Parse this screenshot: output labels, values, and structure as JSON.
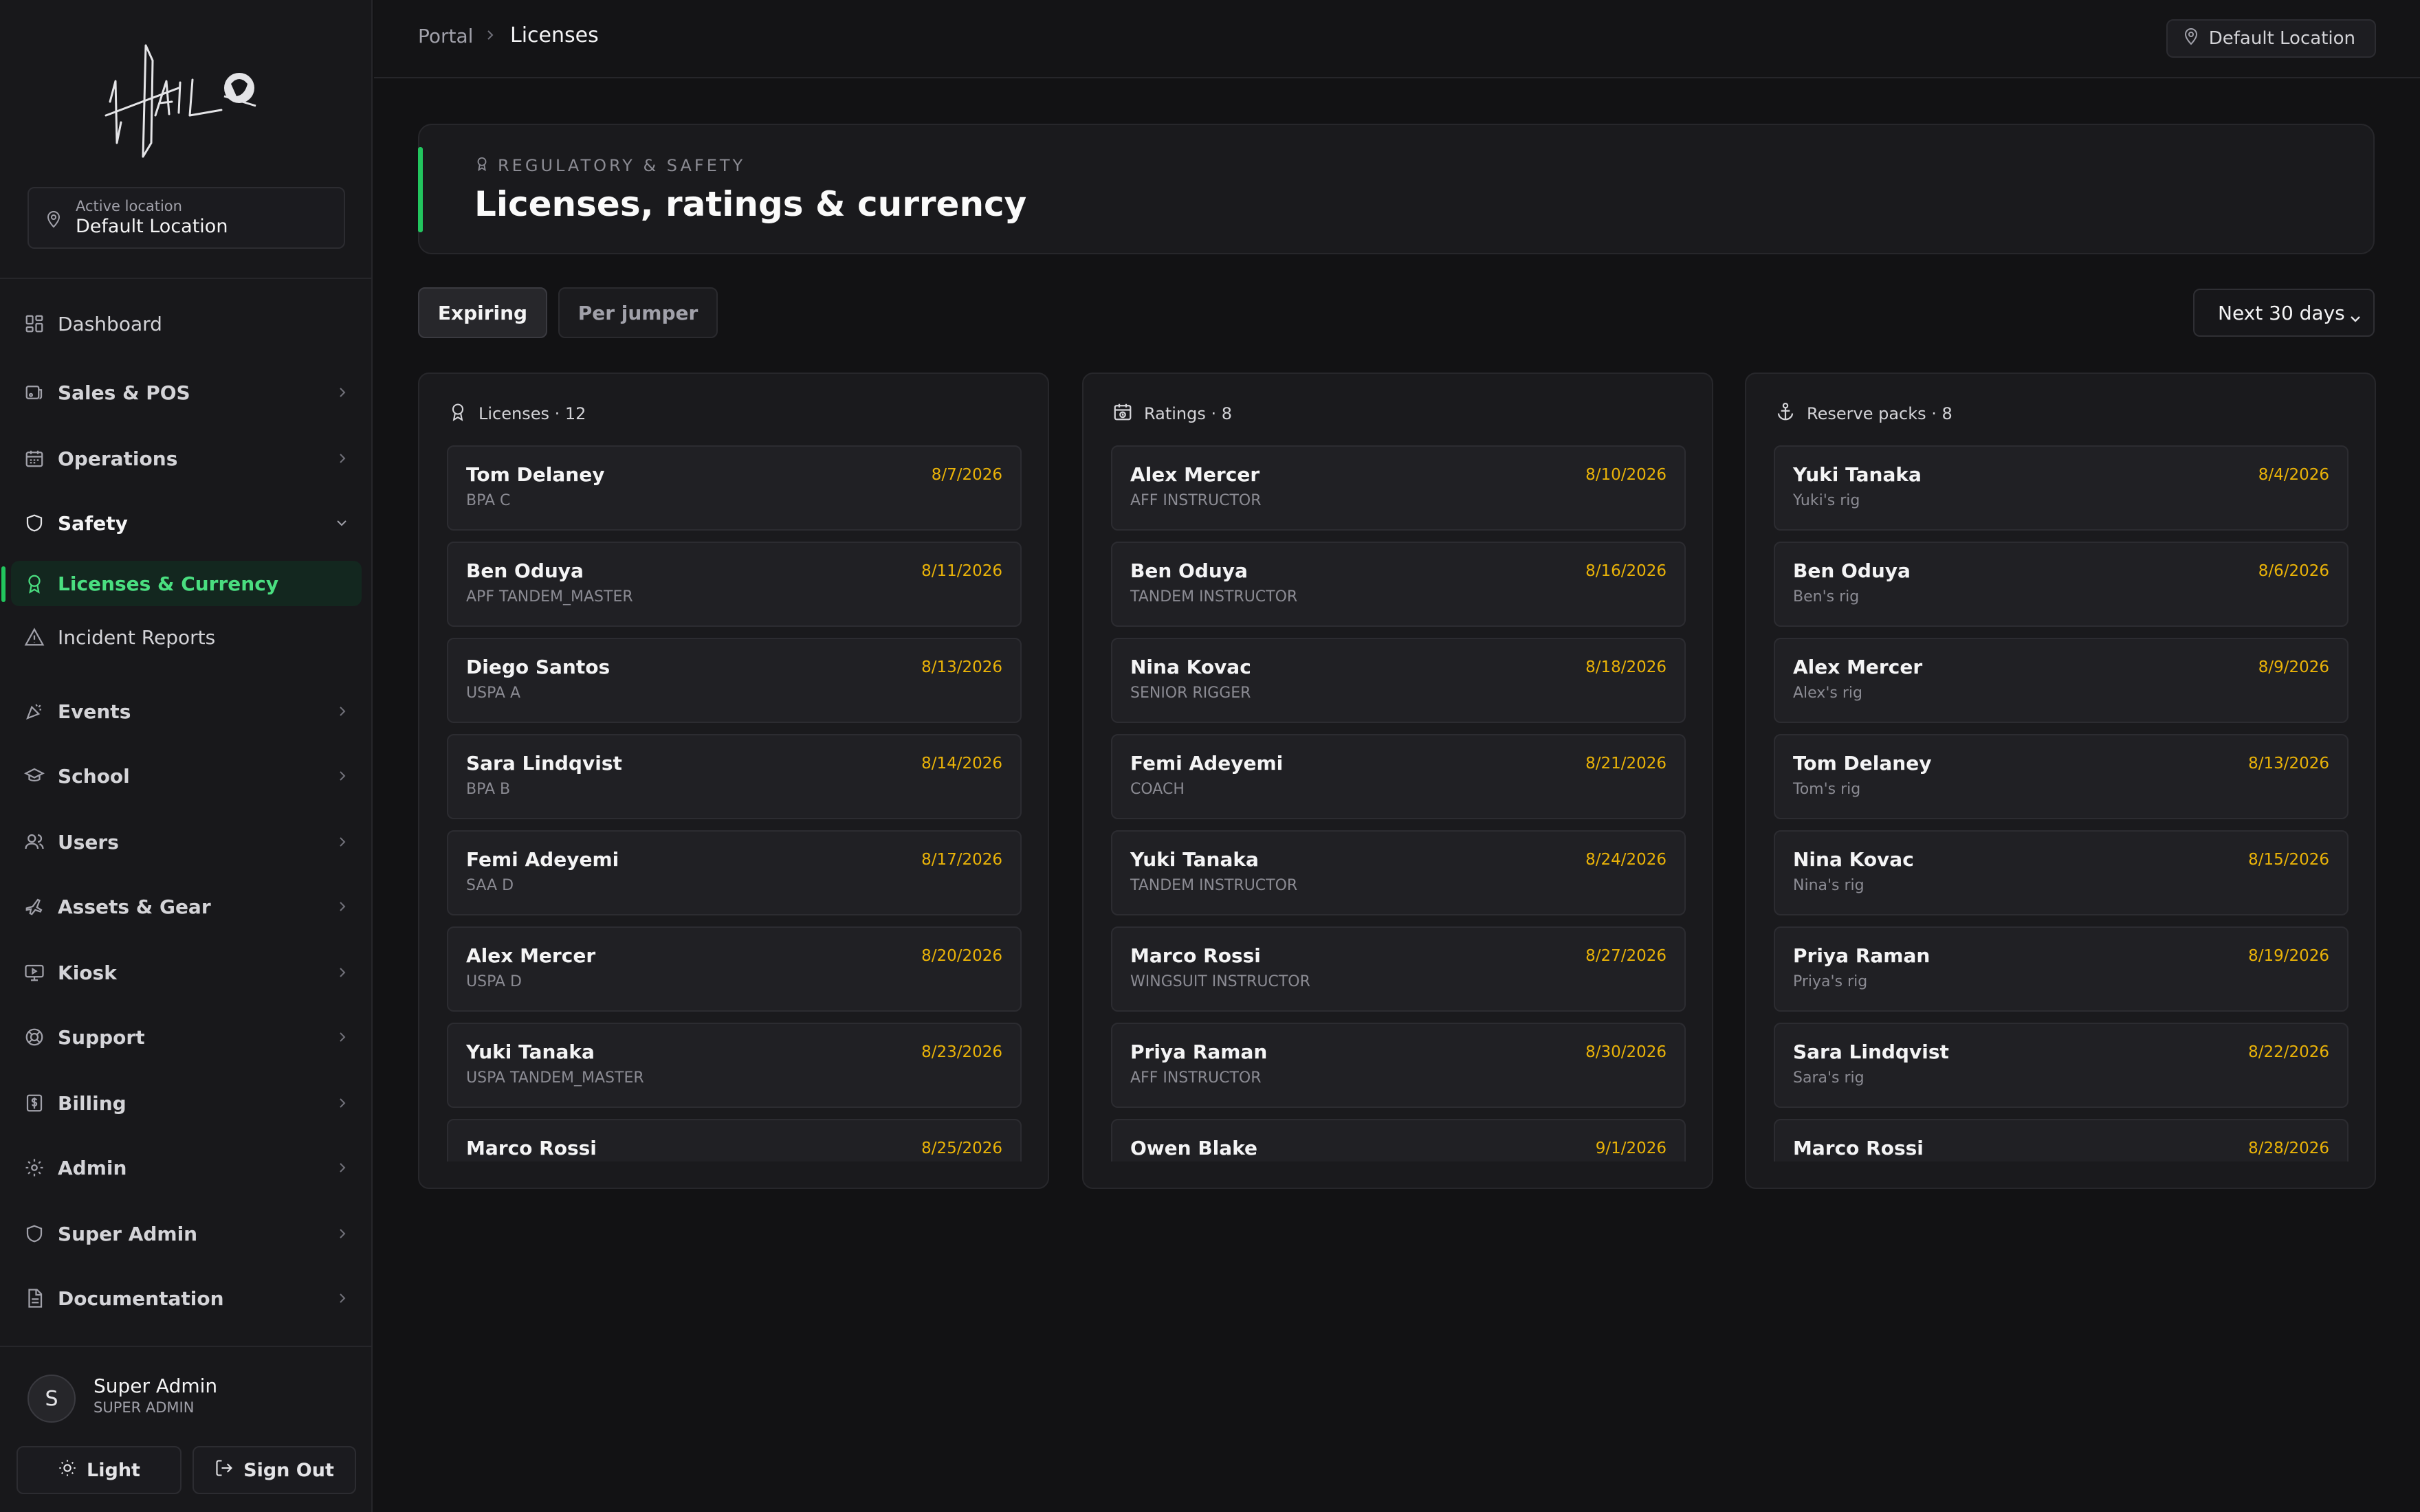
{
  "sidebar": {
    "active_location_label": "Active location",
    "active_location_value": "Default Location",
    "nav": [
      {
        "label": "Dashboard",
        "icon": "grid-icon"
      },
      {
        "label": "Sales & POS",
        "icon": "receipt-icon"
      },
      {
        "label": "Operations",
        "icon": "calendar-icon"
      },
      {
        "label": "Safety",
        "icon": "shield-icon"
      },
      {
        "label": "Licenses & Currency",
        "icon": "award-icon"
      },
      {
        "label": "Incident Reports",
        "icon": "warning-icon"
      },
      {
        "label": "Events",
        "icon": "party-icon"
      },
      {
        "label": "School",
        "icon": "graduation-cap-icon"
      },
      {
        "label": "Users",
        "icon": "users-icon"
      },
      {
        "label": "Assets & Gear",
        "icon": "plane-icon"
      },
      {
        "label": "Kiosk",
        "icon": "monitor-play-icon"
      },
      {
        "label": "Support",
        "icon": "lifebuoy-icon"
      },
      {
        "label": "Billing",
        "icon": "dollar-icon"
      },
      {
        "label": "Admin",
        "icon": "gear-icon"
      },
      {
        "label": "Super Admin",
        "icon": "shield-icon"
      },
      {
        "label": "Documentation",
        "icon": "document-icon"
      }
    ],
    "user": {
      "initial": "S",
      "name": "Super Admin",
      "role": "SUPER ADMIN"
    },
    "theme_button": "Light",
    "signout_button": "Sign Out"
  },
  "topbar": {
    "crumb_root": "Portal",
    "crumb_current": "Licenses",
    "location_button": "Default Location"
  },
  "header": {
    "eyebrow": "REGULATORY & SAFETY",
    "title": "Licenses, ratings & currency"
  },
  "tabs": {
    "expiring": "Expiring",
    "per_jumper": "Per jumper"
  },
  "range_select": "Next 30 days",
  "columns": [
    {
      "title": "Licenses · 12",
      "icon": "award-icon",
      "rows": [
        {
          "name": "Tom Delaney",
          "sub": "BPA C",
          "date": "8/7/2026"
        },
        {
          "name": "Ben Oduya",
          "sub": "APF TANDEM_MASTER",
          "date": "8/11/2026"
        },
        {
          "name": "Diego Santos",
          "sub": "USPA A",
          "date": "8/13/2026"
        },
        {
          "name": "Sara Lindqvist",
          "sub": "BPA B",
          "date": "8/14/2026"
        },
        {
          "name": "Femi Adeyemi",
          "sub": "SAA D",
          "date": "8/17/2026"
        },
        {
          "name": "Alex Mercer",
          "sub": "USPA D",
          "date": "8/20/2026"
        },
        {
          "name": "Yuki Tanaka",
          "sub": "USPA TANDEM_MASTER",
          "date": "8/23/2026"
        },
        {
          "name": "Marco Rossi",
          "sub": "",
          "date": "8/25/2026"
        }
      ]
    },
    {
      "title": "Ratings · 8",
      "icon": "calendar-clock-icon",
      "rows": [
        {
          "name": "Alex Mercer",
          "sub": "AFF INSTRUCTOR",
          "date": "8/10/2026"
        },
        {
          "name": "Ben Oduya",
          "sub": "TANDEM INSTRUCTOR",
          "date": "8/16/2026"
        },
        {
          "name": "Nina Kovac",
          "sub": "SENIOR RIGGER",
          "date": "8/18/2026"
        },
        {
          "name": "Femi Adeyemi",
          "sub": "COACH",
          "date": "8/21/2026"
        },
        {
          "name": "Yuki Tanaka",
          "sub": "TANDEM INSTRUCTOR",
          "date": "8/24/2026"
        },
        {
          "name": "Marco Rossi",
          "sub": "WINGSUIT INSTRUCTOR",
          "date": "8/27/2026"
        },
        {
          "name": "Priya Raman",
          "sub": "AFF INSTRUCTOR",
          "date": "8/30/2026"
        },
        {
          "name": "Owen Blake",
          "sub": "",
          "date": "9/1/2026"
        }
      ]
    },
    {
      "title": "Reserve packs · 8",
      "icon": "anchor-icon",
      "rows": [
        {
          "name": "Yuki Tanaka",
          "sub": "Yuki's rig",
          "date": "8/4/2026"
        },
        {
          "name": "Ben Oduya",
          "sub": "Ben's rig",
          "date": "8/6/2026"
        },
        {
          "name": "Alex Mercer",
          "sub": "Alex's rig",
          "date": "8/9/2026"
        },
        {
          "name": "Tom Delaney",
          "sub": "Tom's rig",
          "date": "8/13/2026"
        },
        {
          "name": "Nina Kovac",
          "sub": "Nina's rig",
          "date": "8/15/2026"
        },
        {
          "name": "Priya Raman",
          "sub": "Priya's rig",
          "date": "8/19/2026"
        },
        {
          "name": "Sara Lindqvist",
          "sub": "Sara's rig",
          "date": "8/22/2026"
        },
        {
          "name": "Marco Rossi",
          "sub": "",
          "date": "8/28/2026"
        }
      ]
    }
  ],
  "colors": {
    "accent": "#22c55e",
    "accent_text": "#4ade80",
    "date": "#eab308",
    "background": "#121214",
    "panel": "#1a1a1d"
  }
}
